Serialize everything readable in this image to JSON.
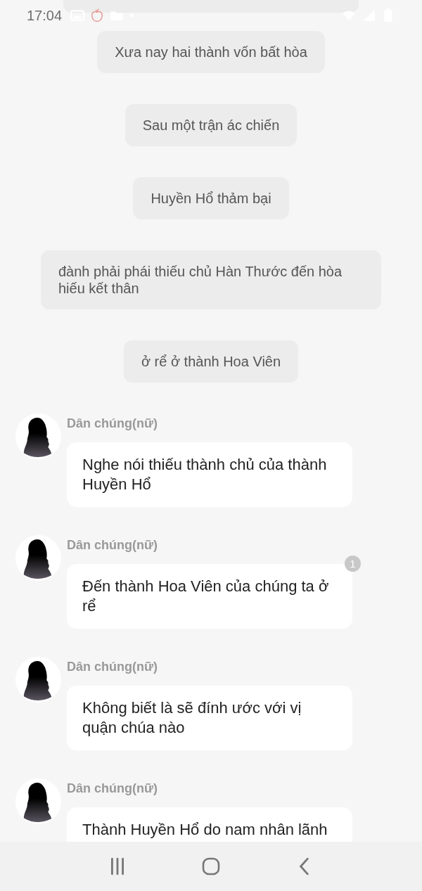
{
  "status_bar": {
    "time": "17:04"
  },
  "narrations": [
    {
      "text": "Xưa nay hai thành vốn bất hòa"
    },
    {
      "text": "Sau một trận ác chiến"
    },
    {
      "text": "Huyền Hổ thảm bại"
    },
    {
      "text": "đành phải phái thiếu chủ Hàn Thước đến hòa hiếu kết thân"
    },
    {
      "text": "ở rể ở thành Hoa Viên"
    }
  ],
  "messages": [
    {
      "sender": "Dân chúng(nữ)",
      "text": "Nghe nói thiếu thành chủ của thành Huyền Hổ"
    },
    {
      "sender": "Dân chúng(nữ)",
      "text": "Đến thành Hoa Viên của chúng ta ở rể",
      "badge": "1"
    },
    {
      "sender": "Dân chúng(nữ)",
      "text": "Không biết là sẽ đính ước với vị quận chúa nào"
    },
    {
      "sender": "Dân chúng(nữ)",
      "text": "Thành Huyền Hổ do nam nhân lãnh"
    }
  ]
}
